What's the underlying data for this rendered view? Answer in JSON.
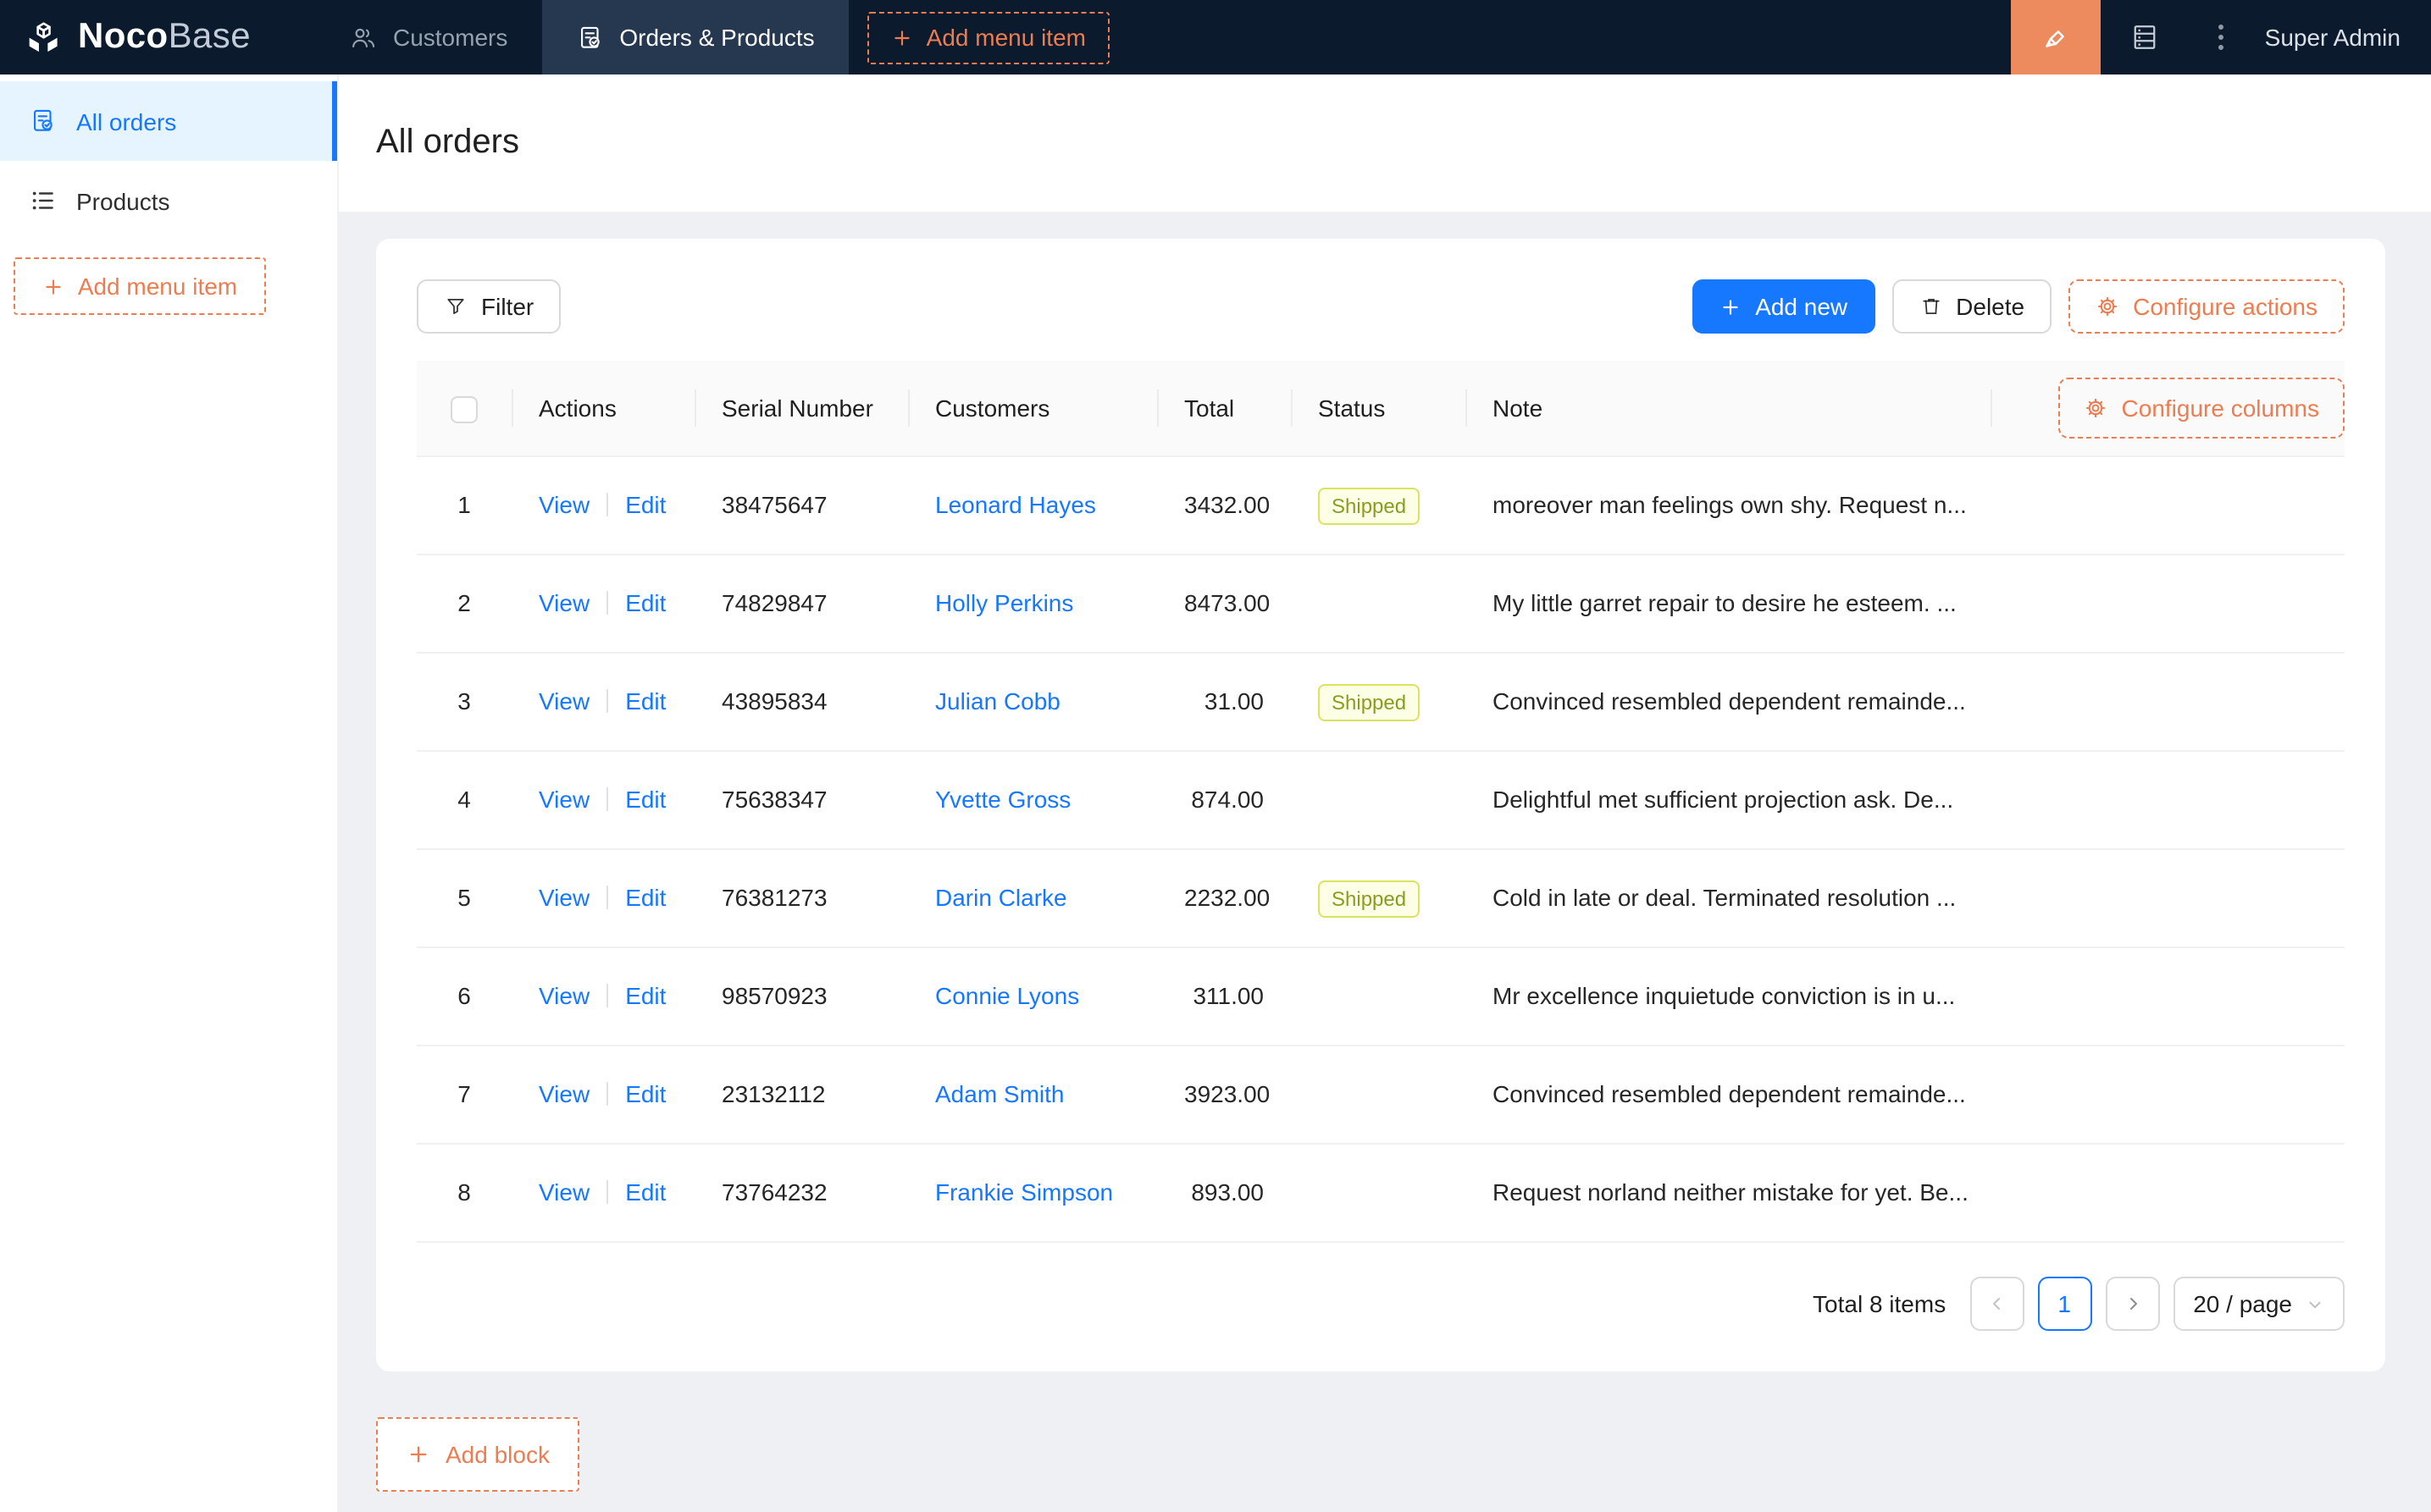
{
  "nav": {
    "logo": {
      "bold": "Noco",
      "light": "Base"
    },
    "tabs": [
      {
        "label": "Customers",
        "active": false
      },
      {
        "label": "Orders & Products",
        "active": true
      }
    ],
    "add_menu_item_label": "Add menu item",
    "user": "Super Admin"
  },
  "sidebar": {
    "items": [
      {
        "label": "All orders",
        "active": true
      },
      {
        "label": "Products",
        "active": false
      }
    ],
    "add_menu_item_label": "Add menu item"
  },
  "page": {
    "title": "All orders"
  },
  "toolbar": {
    "filter_label": "Filter",
    "add_new_label": "Add new",
    "delete_label": "Delete",
    "configure_actions_label": "Configure actions"
  },
  "table": {
    "configure_columns_label": "Configure columns",
    "columns": [
      "Actions",
      "Serial Number",
      "Customers",
      "Total",
      "Status",
      "Note"
    ],
    "actions": {
      "view": "View",
      "edit": "Edit"
    },
    "rows": [
      {
        "index": "1",
        "serial": "38475647",
        "customer": "Leonard Hayes",
        "total": "3432.00",
        "status": "Shipped",
        "note": "moreover man feelings own shy. Request n..."
      },
      {
        "index": "2",
        "serial": "74829847",
        "customer": "Holly Perkins",
        "total": "8473.00",
        "status": "",
        "note": "My little garret repair to desire he esteem. ..."
      },
      {
        "index": "3",
        "serial": "43895834",
        "customer": "Julian Cobb",
        "total": "31.00",
        "status": "Shipped",
        "note": "Convinced resembled dependent remainde..."
      },
      {
        "index": "4",
        "serial": "75638347",
        "customer": "Yvette Gross",
        "total": "874.00",
        "status": "",
        "note": "Delightful met sufficient projection ask. De..."
      },
      {
        "index": "5",
        "serial": "76381273",
        "customer": "Darin Clarke",
        "total": "2232.00",
        "status": "Shipped",
        "note": "Cold in late or deal. Terminated resolution ..."
      },
      {
        "index": "6",
        "serial": "98570923",
        "customer": "Connie Lyons",
        "total": "311.00",
        "status": "",
        "note": "Mr excellence inquietude conviction is in u..."
      },
      {
        "index": "7",
        "serial": "23132112",
        "customer": "Adam Smith",
        "total": "3923.00",
        "status": "",
        "note": "Convinced resembled dependent remainde..."
      },
      {
        "index": "8",
        "serial": "73764232",
        "customer": "Frankie Simpson",
        "total": "893.00",
        "status": "",
        "note": "Request norland neither mistake for yet. Be..."
      }
    ],
    "pagination": {
      "total_label": "Total 8 items",
      "current_page": "1",
      "page_size": "20 / page"
    }
  },
  "footer": {
    "add_block_label": "Add block"
  },
  "icons": [
    "nocobase-logo",
    "customers-icon",
    "orders-icon",
    "plus-icon",
    "highlighter-icon",
    "server-icon",
    "kebab-icon",
    "list-icon",
    "filter-icon",
    "trash-icon",
    "gear-icon",
    "chevron-left-icon",
    "chevron-right-icon",
    "chevron-down-icon",
    "checkbox"
  ],
  "colors": {
    "primary_blue": "#1677FF",
    "designer_orange": "#ED7D51",
    "navbar_bg": "#0B1A2C",
    "navbar_active_tab_bg": "#263750",
    "sidebar_active_bg": "#E6F4FF",
    "content_bg": "#EEF0F4",
    "tag_shipped_bg": "#FCFFE6",
    "tag_shipped_border": "#DBE25E",
    "tag_shipped_text": "#8B9C1F"
  }
}
